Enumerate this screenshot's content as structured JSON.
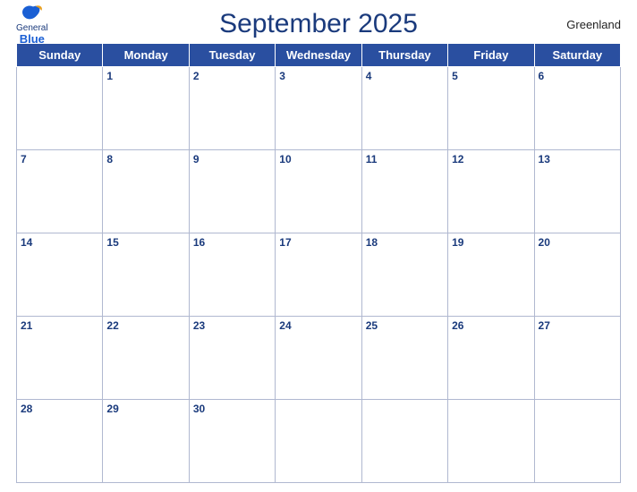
{
  "header": {
    "title": "September 2025",
    "region": "Greenland",
    "logo": {
      "line1": "General",
      "line2": "Blue"
    }
  },
  "days_of_week": [
    "Sunday",
    "Monday",
    "Tuesday",
    "Wednesday",
    "Thursday",
    "Friday",
    "Saturday"
  ],
  "weeks": [
    [
      "",
      "1",
      "2",
      "3",
      "4",
      "5",
      "6"
    ],
    [
      "7",
      "8",
      "9",
      "10",
      "11",
      "12",
      "13"
    ],
    [
      "14",
      "15",
      "16",
      "17",
      "18",
      "19",
      "20"
    ],
    [
      "21",
      "22",
      "23",
      "24",
      "25",
      "26",
      "27"
    ],
    [
      "28",
      "29",
      "30",
      "",
      "",
      "",
      ""
    ]
  ],
  "colors": {
    "header_bg": "#2a4fa0",
    "header_text": "#ffffff",
    "title_color": "#1a3a7c",
    "day_num_color": "#1a3a7c"
  }
}
